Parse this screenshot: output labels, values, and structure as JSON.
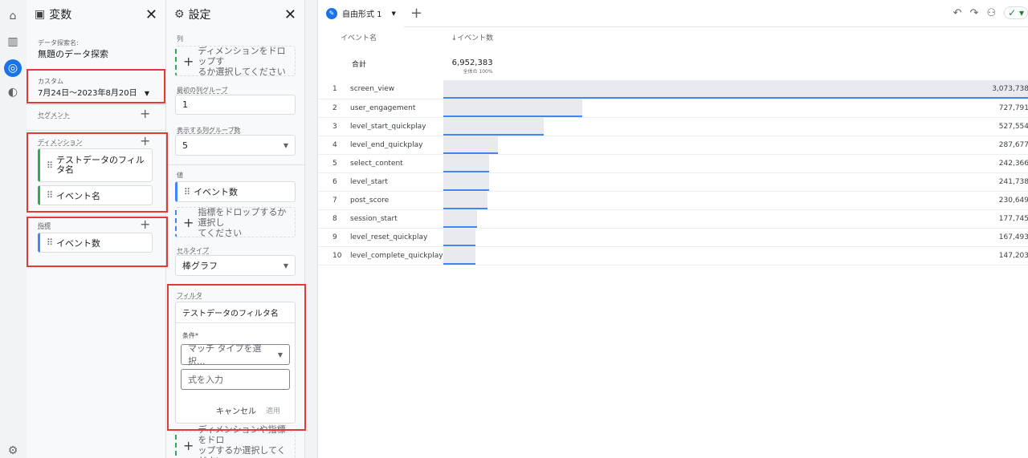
{
  "variables_panel": {
    "title": "変数",
    "exploration_name_label": "データ探索名:",
    "exploration_name": "無題のデータ探索",
    "date_label": "カスタム",
    "date_range": "7月24日～2023年8月20日",
    "segment_label": "セグメント",
    "dimension_label": "ディメンション",
    "dimensions": [
      "テストデータのフィル\nタ名",
      "イベント名"
    ],
    "metric_label": "指標",
    "metrics": [
      "イベント数"
    ]
  },
  "settings_panel": {
    "title": "設定",
    "columns_label": "列",
    "columns_drop": "ディメンションをドロップす\nるか選択してください",
    "first_col_group_label": "最初の列グループ",
    "first_col_group": "1",
    "display_col_groups_label": "表示する列グループ数",
    "display_col_groups": "5",
    "values_label": "値",
    "value_chip": "イベント数",
    "values_drop": "指標をドロップするか選択し\nてください",
    "cell_type_label": "セルタイプ",
    "cell_type": "棒グラフ",
    "filter_label": "フィルタ",
    "filter_name": "テストデータのフィルタ名",
    "condition_label": "条件*",
    "match_type_placeholder": "マッチ タイプを選択...",
    "expression_placeholder": "式を入力",
    "cancel": "キャンセル",
    "apply": "適用",
    "filter_drop": "ディメンションや指標をドロ\nップするか選択してください"
  },
  "main": {
    "tab_label": "自由形式 1",
    "col_dimension": "イベント名",
    "col_metric": "↓イベント数",
    "total_label": "合計",
    "total_value": "6,952,383",
    "total_pct": "全体の 100%",
    "max_value": 3073738,
    "rows": [
      {
        "idx": "1",
        "name": "screen_view",
        "value": 3073738,
        "display": "3,073,738"
      },
      {
        "idx": "2",
        "name": "user_engagement",
        "value": 727791,
        "display": "727,791"
      },
      {
        "idx": "3",
        "name": "level_start_quickplay",
        "value": 527554,
        "display": "527,554"
      },
      {
        "idx": "4",
        "name": "level_end_quickplay",
        "value": 287677,
        "display": "287,677"
      },
      {
        "idx": "5",
        "name": "select_content",
        "value": 242366,
        "display": "242,366"
      },
      {
        "idx": "6",
        "name": "level_start",
        "value": 241738,
        "display": "241,738"
      },
      {
        "idx": "7",
        "name": "post_score",
        "value": 230649,
        "display": "230,649"
      },
      {
        "idx": "8",
        "name": "session_start",
        "value": 177745,
        "display": "177,745"
      },
      {
        "idx": "9",
        "name": "level_reset_quickplay",
        "value": 167493,
        "display": "167,493"
      },
      {
        "idx": "10",
        "name": "level_complete_quickplay",
        "value": 147203,
        "display": "147,203"
      }
    ]
  },
  "colors": {
    "accent": "#1a73e8",
    "dimension": "#34a853",
    "metric": "#4285f4",
    "highlight": "#e53935"
  }
}
